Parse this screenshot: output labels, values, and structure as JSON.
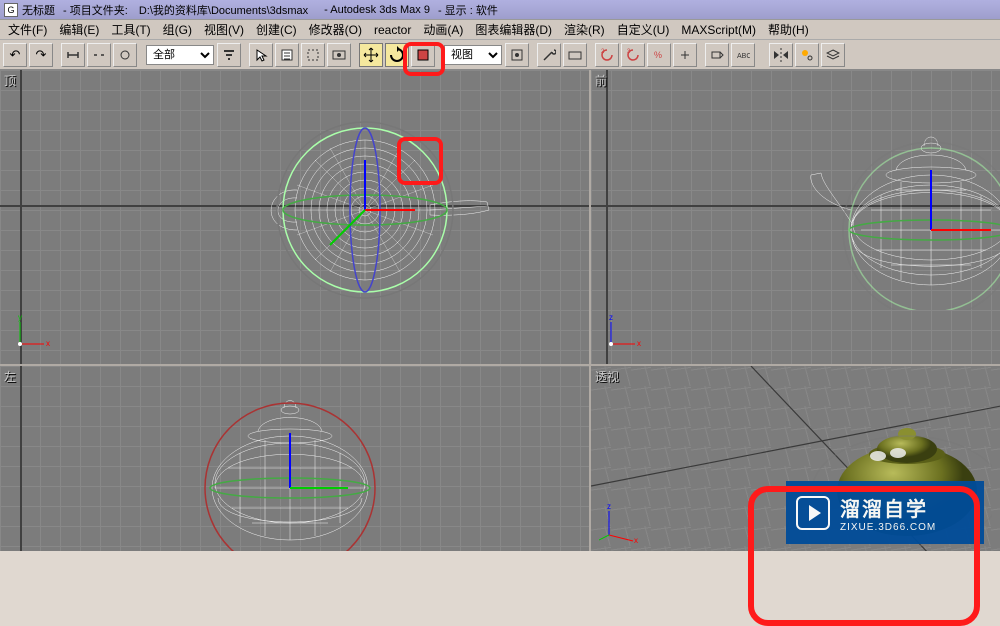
{
  "title": {
    "untitled": "无标题",
    "project_prefix": "- 项目文件夹: ",
    "project_path": "D:\\我的资料库\\Documents\\3dsmax",
    "app": "- Autodesk 3ds Max 9",
    "display": "- 显示 : 软件"
  },
  "menu": {
    "items": [
      "文件(F)",
      "编辑(E)",
      "工具(T)",
      "组(G)",
      "视图(V)",
      "创建(C)",
      "修改器(O)",
      "reactor",
      "动画(A)",
      "图表编辑器(D)",
      "渲染(R)",
      "自定义(U)",
      "MAXScript(M)",
      "帮助(H)"
    ]
  },
  "toolbar": {
    "filter_label": "全部",
    "view_label": "视图"
  },
  "viewports": {
    "tl": "顶",
    "tr": "前",
    "bl": "左",
    "br": "透视"
  },
  "watermark": {
    "big": "溜溜自学",
    "small": "ZIXUE.3D66.COM"
  }
}
